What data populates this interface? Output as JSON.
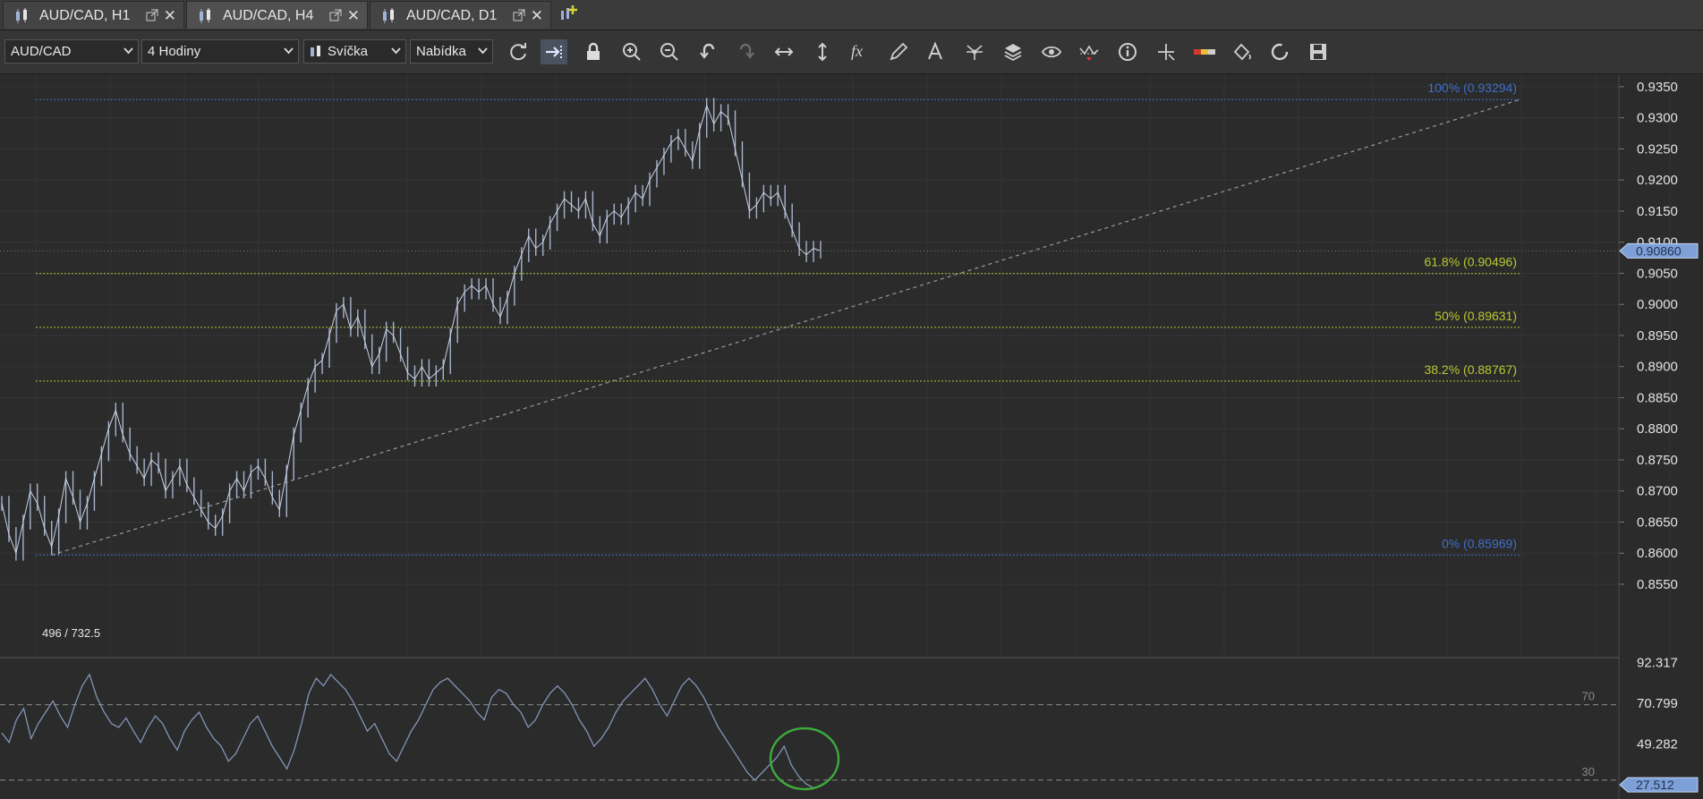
{
  "tabs": [
    {
      "label": "AUD/CAD, H1",
      "close": "✕"
    },
    {
      "label": "AUD/CAD, H4",
      "close": "✕"
    },
    {
      "label": "AUD/CAD, D1",
      "close": "✕"
    }
  ],
  "toolbar": {
    "instrument": "AUD/CAD",
    "period": "4 Hodiny",
    "chart_type": "Svíčka",
    "offer_side": "Nabídka",
    "icons": [
      "refresh-icon",
      "auto-shift-icon",
      "lock-icon",
      "zoom-in-icon",
      "zoom-out-icon",
      "undo-icon",
      "redo-icon",
      "horizontal-scale-icon",
      "vertical-scale-icon",
      "indicator-fx-icon",
      "draw-pencil-icon",
      "text-tool-icon",
      "pattern-icon",
      "layers-icon",
      "eye-icon",
      "oscillator-icon",
      "info-icon",
      "crosshair-icon",
      "color-theme-icon",
      "fill-icon",
      "cycle-icon",
      "save-icon"
    ]
  },
  "colors": {
    "background": "#2b2b2b",
    "price_line": "#a7b4cf",
    "fib_blue": "#3f6fc9",
    "fib_yellow": "#b7c832",
    "rsi_line": "#8395b8",
    "highlight_circle": "#3caa3c"
  },
  "chart_data": {
    "type": "line",
    "instrument": "AUD/CAD",
    "period": "H4",
    "price_axis": {
      "ticks": [
        "0.9350",
        "0.9300",
        "0.9250",
        "0.9200",
        "0.9150",
        "0.9100",
        "0.9050",
        "0.9000",
        "0.8950",
        "0.8900",
        "0.8850",
        "0.8800",
        "0.8750",
        "0.8700",
        "0.8650",
        "0.8600",
        "0.8550"
      ],
      "ylim": [
        0.855,
        0.937
      ],
      "current_price": "0.90860"
    },
    "price_series": [
      0.868,
      0.863,
      0.86,
      0.865,
      0.87,
      0.868,
      0.864,
      0.861,
      0.866,
      0.872,
      0.869,
      0.865,
      0.868,
      0.872,
      0.876,
      0.88,
      0.883,
      0.879,
      0.876,
      0.874,
      0.872,
      0.875,
      0.874,
      0.87,
      0.872,
      0.874,
      0.871,
      0.869,
      0.867,
      0.865,
      0.864,
      0.866,
      0.87,
      0.872,
      0.87,
      0.873,
      0.874,
      0.872,
      0.869,
      0.867,
      0.873,
      0.879,
      0.883,
      0.887,
      0.89,
      0.891,
      0.895,
      0.899,
      0.9,
      0.896,
      0.898,
      0.894,
      0.89,
      0.892,
      0.896,
      0.895,
      0.892,
      0.889,
      0.888,
      0.89,
      0.888,
      0.889,
      0.89,
      0.895,
      0.9,
      0.902,
      0.903,
      0.902,
      0.903,
      0.9,
      0.898,
      0.901,
      0.905,
      0.908,
      0.911,
      0.909,
      0.91,
      0.913,
      0.915,
      0.917,
      0.916,
      0.915,
      0.917,
      0.913,
      0.911,
      0.914,
      0.915,
      0.914,
      0.916,
      0.918,
      0.917,
      0.92,
      0.922,
      0.924,
      0.926,
      0.927,
      0.925,
      0.923,
      0.928,
      0.932,
      0.929,
      0.931,
      0.93,
      0.925,
      0.92,
      0.915,
      0.916,
      0.918,
      0.917,
      0.918,
      0.915,
      0.912,
      0.909,
      0.908,
      0.909,
      0.9086
    ],
    "fibonacci": [
      {
        "label": "100% (0.93294)",
        "value": 0.93294,
        "color": "blue"
      },
      {
        "label": "61.8% (0.90496)",
        "value": 0.90496,
        "color": "yellow"
      },
      {
        "label": "50% (0.89631)",
        "value": 0.89631,
        "color": "yellow"
      },
      {
        "label": "38.2% (0.88767)",
        "value": 0.88767,
        "color": "yellow"
      },
      {
        "label": "0% (0.85969)",
        "value": 0.85969,
        "color": "blue"
      }
    ],
    "trendline": {
      "from": 0.8597,
      "to": 0.933
    },
    "ruler_label": "496 / 732.5",
    "rsi": {
      "axis_ticks": [
        "92.317",
        "70.799",
        "49.282"
      ],
      "current_value": "27.512",
      "levels": [
        {
          "label": "70",
          "value": 70
        },
        {
          "label": "30",
          "value": 30
        }
      ],
      "ylim": [
        20,
        94
      ],
      "series": [
        55,
        50,
        62,
        68,
        52,
        60,
        66,
        72,
        64,
        58,
        70,
        80,
        86,
        74,
        66,
        60,
        58,
        63,
        56,
        50,
        58,
        64,
        60,
        52,
        46,
        56,
        62,
        66,
        58,
        52,
        48,
        40,
        44,
        52,
        60,
        64,
        56,
        48,
        42,
        36,
        46,
        60,
        76,
        84,
        80,
        86,
        82,
        78,
        72,
        64,
        56,
        60,
        52,
        44,
        40,
        48,
        56,
        62,
        70,
        78,
        82,
        84,
        80,
        76,
        72,
        66,
        62,
        74,
        78,
        76,
        70,
        66,
        58,
        62,
        70,
        76,
        80,
        76,
        70,
        62,
        56,
        48,
        52,
        58,
        66,
        72,
        76,
        80,
        84,
        78,
        70,
        64,
        72,
        80,
        84,
        80,
        74,
        66,
        58,
        52,
        46,
        40,
        34,
        30,
        34,
        38,
        42,
        48,
        38,
        32,
        28,
        26,
        27
      ]
    }
  }
}
